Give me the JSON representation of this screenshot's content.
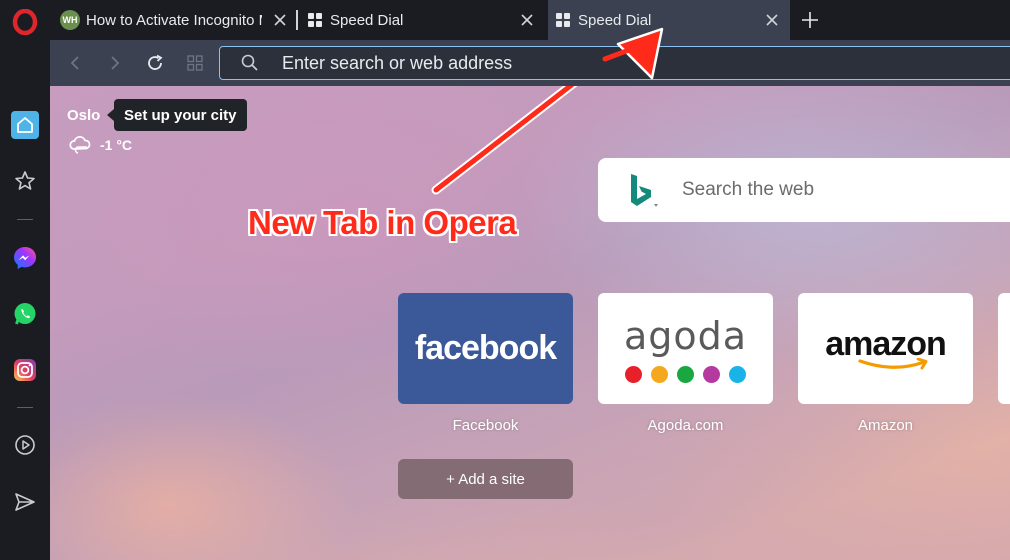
{
  "tabs": [
    {
      "title": "How to Activate Incognito M",
      "favicon": "WH",
      "active": false
    },
    {
      "title": "Speed Dial",
      "active": false
    },
    {
      "title": "Speed Dial",
      "active": true
    }
  ],
  "address_bar": {
    "placeholder": "Enter search or web address"
  },
  "weather": {
    "city": "Oslo",
    "tooltip": "Set up your city",
    "temperature": "-1 °C"
  },
  "web_search": {
    "placeholder": "Search the web"
  },
  "annotation": {
    "text": "New Tab in Opera",
    "color": "#ff2a1a"
  },
  "speed_dial": [
    {
      "name": "Facebook",
      "logo_text": "facebook",
      "color": "#3b5998"
    },
    {
      "name": "Agoda.com",
      "logo_text": "agoda",
      "dot_colors": [
        "#e8202a",
        "#f4a81d",
        "#1aa640",
        "#b53aa0",
        "#1ab3e8"
      ]
    },
    {
      "name": "Amazon",
      "logo_text": "amazon"
    }
  ],
  "add_site": {
    "label": "+  Add a site"
  },
  "colors": {
    "accent": "#4fb3e8",
    "sidebar": "#1a1c21",
    "toolbar": "#3b4150"
  }
}
